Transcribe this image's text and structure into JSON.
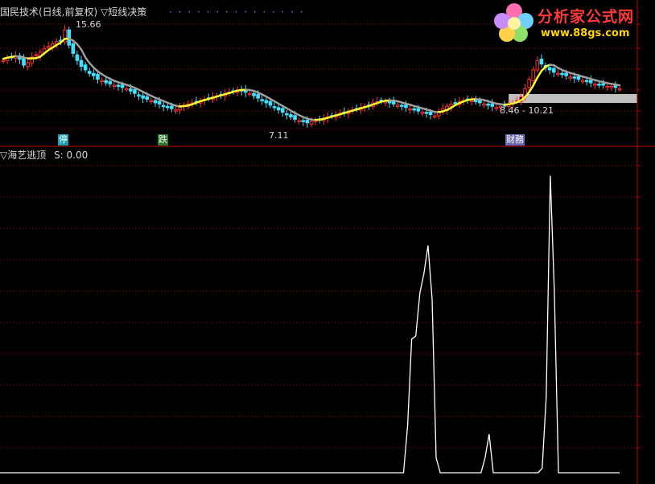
{
  "window": {
    "upper_title": "国民技术(日线,前复权)",
    "upper_indicator": "▽短线决策",
    "lower_title": "▽海艺逃顶",
    "lower_value": "S: 0.00"
  },
  "logo": {
    "text": "分析家公式网",
    "url": "www.88gs.com"
  },
  "badges": [
    {
      "label": "停",
      "color": "#1aa0b0"
    },
    {
      "label": "跌",
      "color": "#2c7a2c"
    },
    {
      "label": "财務",
      "color": "#6a6ab0"
    }
  ],
  "colors": {
    "grid": "#a00000",
    "axis": "#c00000",
    "up_candle": "#ff3030",
    "down_candle": "#40e0ff",
    "trend_up": "#ffff30",
    "trend_down": "#a0a0a0",
    "signal_line": "#ffffff",
    "highlight_band": "#c0c0c0"
  },
  "chart_data": [
    {
      "type": "candlestick",
      "title": "国民技术(日线,前复权)",
      "annotations": [
        {
          "text": "15.66",
          "kind": "high_marker"
        },
        {
          "text": "7.11",
          "kind": "low_marker"
        },
        {
          "text": "8.46 - 10.21",
          "kind": "range_label"
        }
      ],
      "price_high": 15.66,
      "price_low": 7.11,
      "range_band": [
        8.46,
        10.21
      ],
      "closes": [
        12.6,
        12.8,
        12.9,
        13.0,
        12.7,
        12.2,
        12.4,
        12.9,
        13.1,
        13.3,
        13.6,
        13.8,
        14.0,
        14.2,
        14.3,
        15.2,
        13.9,
        13.2,
        12.6,
        12.1,
        11.8,
        11.5,
        11.3,
        11.0,
        10.9,
        10.7,
        10.6,
        10.5,
        10.4,
        10.3,
        10.2,
        10.0,
        9.8,
        9.6,
        9.4,
        9.3,
        9.2,
        9.0,
        8.9,
        8.7,
        8.6,
        8.5,
        8.4,
        8.6,
        8.8,
        8.9,
        9.0,
        9.1,
        9.2,
        9.3,
        9.4,
        9.5,
        9.6,
        9.7,
        9.8,
        9.9,
        10.0,
        10.1,
        10.0,
        9.9,
        9.8,
        9.6,
        9.4,
        9.2,
        9.0,
        8.8,
        8.6,
        8.4,
        8.2,
        8.0,
        7.8,
        7.6,
        7.5,
        7.4,
        7.3,
        7.4,
        7.5,
        7.6,
        7.7,
        7.8,
        7.9,
        8.0,
        8.1,
        8.2,
        8.3,
        8.4,
        8.5,
        8.6,
        8.7,
        8.8,
        9.0,
        9.1,
        9.2,
        9.1,
        9.0,
        8.9,
        8.8,
        8.7,
        8.6,
        8.5,
        8.4,
        8.3,
        8.2,
        8.1,
        8.0,
        7.9,
        8.2,
        8.5,
        8.7,
        8.9,
        9.0,
        9.1,
        9.2,
        9.3,
        9.2,
        9.1,
        9.0,
        8.9,
        8.8,
        8.7,
        8.6,
        8.7,
        8.8,
        8.9,
        9.0,
        9.2,
        9.5,
        10.2,
        11.0,
        11.8,
        12.6,
        12.3,
        12.0,
        11.8,
        11.6,
        11.5,
        11.4,
        11.3,
        11.2,
        11.1,
        11.0,
        10.9,
        10.8,
        10.7,
        10.6,
        10.5,
        10.5,
        10.4,
        10.4,
        10.3,
        10.2
      ]
    },
    {
      "type": "line",
      "title": "▽海艺逃顶",
      "series": [
        {
          "name": "S",
          "values": [
            0,
            0,
            0,
            0,
            0,
            0,
            0,
            0,
            0,
            0,
            0,
            0,
            0,
            0,
            0,
            0,
            0,
            0,
            0,
            0,
            0,
            0,
            0,
            0,
            0,
            0,
            0,
            0,
            0,
            0,
            0,
            0,
            0,
            0,
            0,
            0,
            0,
            0,
            0,
            0,
            0,
            0,
            0,
            0,
            0,
            0,
            0,
            0,
            0,
            0,
            0,
            0,
            0,
            0,
            0,
            0,
            0,
            0,
            0,
            0,
            0,
            0,
            0,
            0,
            0,
            0,
            0,
            0,
            0,
            0,
            0,
            0,
            0,
            0,
            0,
            0,
            0,
            0,
            0,
            0,
            0,
            0,
            0,
            0,
            0,
            0,
            0,
            0,
            0,
            0,
            0,
            0,
            0,
            0,
            0,
            0,
            0,
            0,
            0,
            0,
            3.2,
            9.0,
            9.2,
            12.1,
            13.4,
            15.3,
            11.7,
            1.0,
            0,
            0,
            0,
            0,
            0,
            0,
            0,
            0,
            0,
            0,
            0,
            1.0,
            2.6,
            0,
            0,
            0,
            0,
            0,
            0,
            0,
            0,
            0,
            0,
            0,
            0,
            0.3,
            5.1,
            20.0,
            12.2,
            0,
            0,
            0,
            0,
            0,
            0,
            0,
            0,
            0,
            0,
            0,
            0,
            0,
            0,
            0,
            0
          ]
        }
      ],
      "current_value": 0.0
    }
  ]
}
